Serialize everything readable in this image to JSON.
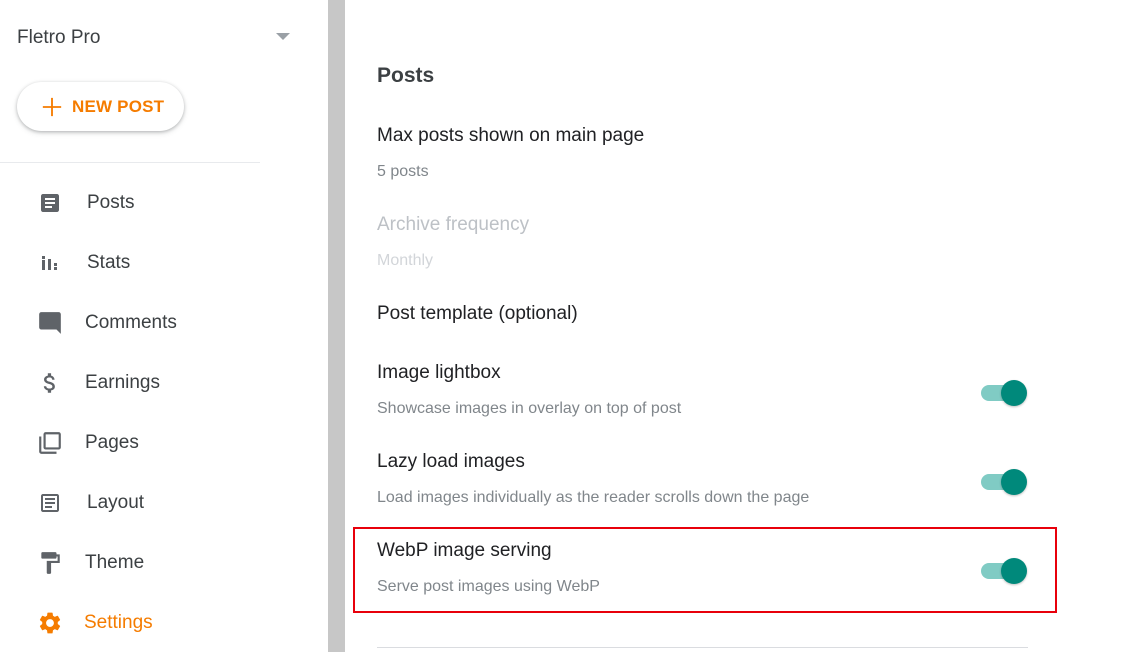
{
  "sidebar": {
    "blog_name": "Fletro Pro",
    "new_post_label": "NEW POST",
    "items": [
      {
        "label": "Posts",
        "icon": "posts-icon"
      },
      {
        "label": "Stats",
        "icon": "stats-icon"
      },
      {
        "label": "Comments",
        "icon": "comments-icon"
      },
      {
        "label": "Earnings",
        "icon": "dollar-icon"
      },
      {
        "label": "Pages",
        "icon": "pages-icon"
      },
      {
        "label": "Layout",
        "icon": "layout-icon"
      },
      {
        "label": "Theme",
        "icon": "paint-roller-icon"
      },
      {
        "label": "Settings",
        "icon": "gear-icon",
        "active": true
      }
    ]
  },
  "main": {
    "section_title": "Posts",
    "max_posts": {
      "title": "Max posts shown on main page",
      "value": "5 posts"
    },
    "archive": {
      "title": "Archive frequency",
      "value": "Monthly",
      "disabled": true
    },
    "post_template": {
      "title": "Post template (optional)"
    },
    "lightbox": {
      "title": "Image lightbox",
      "desc": "Showcase images in overlay on top of post",
      "enabled": true
    },
    "lazy_load": {
      "title": "Lazy load images",
      "desc": "Load images individually as the reader scrolls down the page",
      "enabled": true
    },
    "webp": {
      "title": "WebP image serving",
      "desc": "Serve post images using WebP",
      "enabled": true
    }
  },
  "colors": {
    "accent": "#f57c00",
    "toggle_thumb": "#00897b",
    "toggle_track": "#80cbc4",
    "highlight": "#e8000b",
    "icon": "#5f6368"
  }
}
